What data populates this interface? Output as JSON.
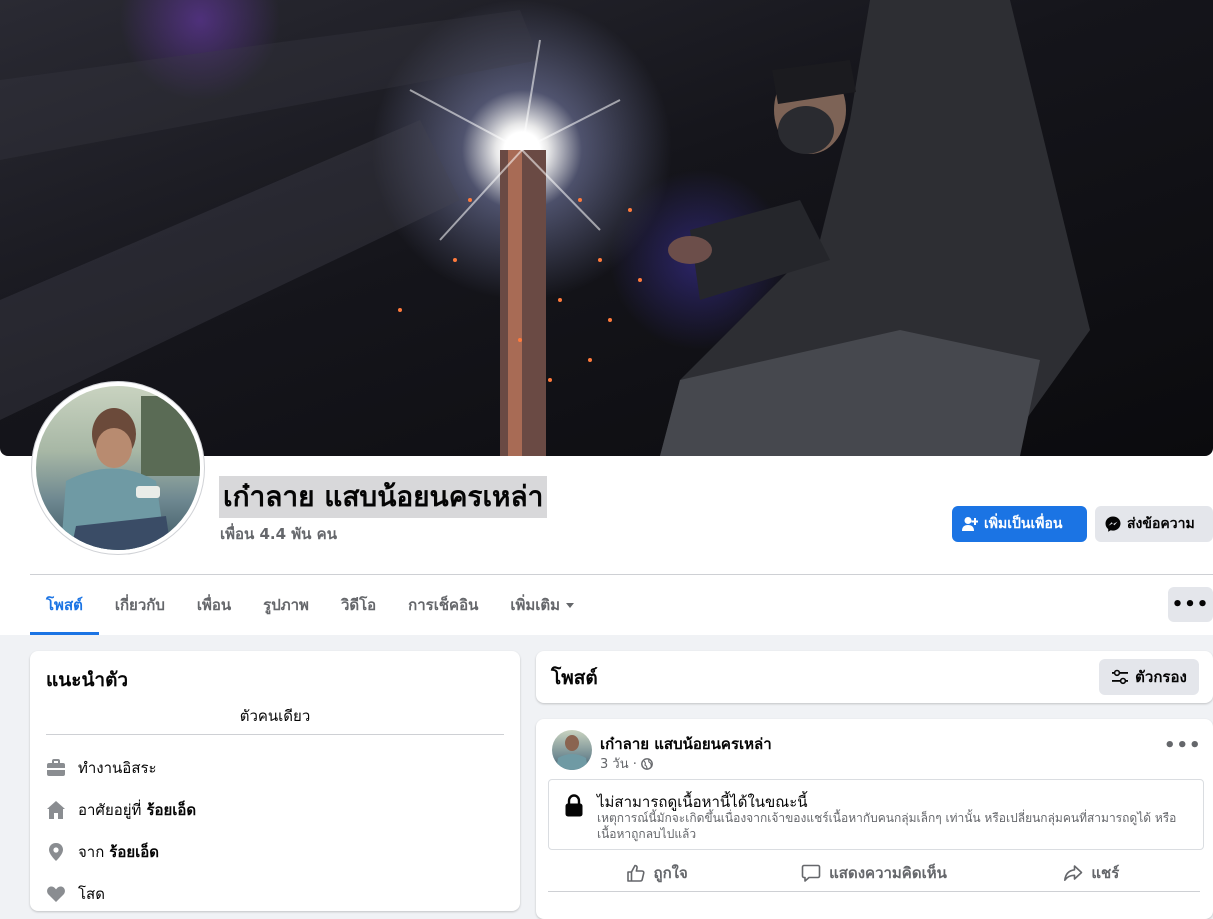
{
  "profile": {
    "name": "เก๋าลาย แสบน้อยนครเหล่า",
    "friend_count": "เพื่อน 4.4 พัน คน",
    "add_friend_label": "เพิ่มเป็นเพื่อน",
    "message_label": "ส่งข้อความ"
  },
  "tabs": [
    {
      "label": "โพสต์",
      "active": true
    },
    {
      "label": "เกี่ยวกับ"
    },
    {
      "label": "เพื่อน"
    },
    {
      "label": "รูปภาพ"
    },
    {
      "label": "วิดีโอ"
    },
    {
      "label": "การเช็คอิน"
    },
    {
      "label": "เพิ่มเติม"
    }
  ],
  "more_button_label": "•••",
  "intro": {
    "title": "แนะนำตัว",
    "bio": "ตัวคนเดียว",
    "work": "ทำงานอิสระ",
    "lives_prefix": "อาศัยอยู่ที่",
    "lives_place": "ร้อยเอ็ด",
    "from_prefix": "จาก",
    "from_place": "ร้อยเอ็ด",
    "relationship": "โสด"
  },
  "posts": {
    "title": "โพสต์",
    "filter_label": "ตัวกรอง"
  },
  "post": {
    "author": "เก๋าลาย แสบน้อยนครเหล่า",
    "time": "3 วัน ·",
    "options_label": "•••",
    "notice_title": "ไม่สามารถดูเนื้อหานี้ได้ในขณะนี้",
    "notice_body": "เหตุการณ์นี้มักจะเกิดขึ้นเนื่องจากเจ้าของแชร์เนื้อหากับคนกลุ่มเล็กๆ เท่านั้น หรือเปลี่ยนกลุ่มคนที่สามารถดูได้ หรือเนื้อหาถูกลบไปแล้ว",
    "like_label": "ถูกใจ",
    "comment_label": "แสดงความคิดเห็น",
    "share_label": "แชร์"
  },
  "colors": {
    "accent": "#1b74e4",
    "page_bg": "#f0f2f5",
    "secondary_text": "#65676b",
    "button_gray": "#e4e6eb"
  },
  "icons": [
    "add-friend-icon",
    "messenger-icon",
    "caret-down-icon",
    "filter-icon",
    "briefcase-icon",
    "home-icon",
    "location-pin-icon",
    "heart-icon",
    "globe-icon",
    "lock-icon",
    "like-icon",
    "comment-icon",
    "share-icon"
  ]
}
